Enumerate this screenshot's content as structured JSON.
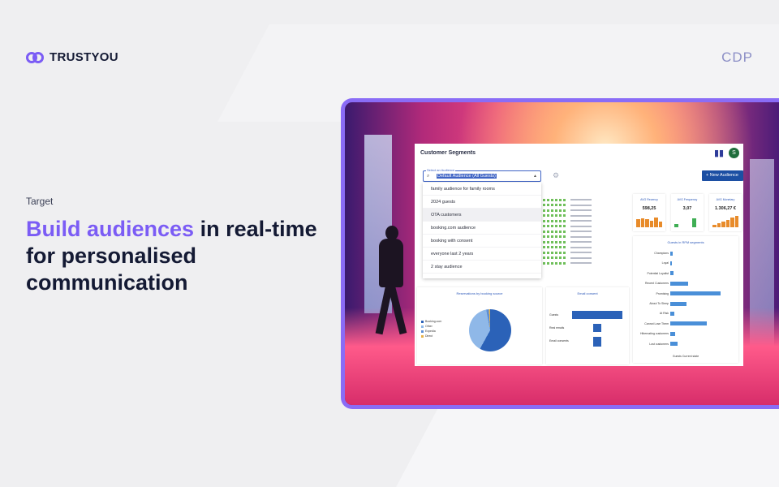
{
  "brand": {
    "name": "TRUSTYOU",
    "product": "CDP"
  },
  "hero": {
    "eyebrow": "Target",
    "headline_accent": "Build audiences",
    "headline_rest": "in real-time for personalised communication"
  },
  "app": {
    "title": "Customer Segments",
    "avatar_initial": "S",
    "select_label": "Select an Audience",
    "select_value": "Default Audience (All Guests)",
    "new_button": "+ New Audience",
    "audiences": [
      "family audience for family rooms",
      "2024 guests",
      "OTA customers",
      "booking.com audience",
      "booking with consent",
      "everyone last 2 years",
      "2 stay audience"
    ],
    "highlighted_index": 2,
    "kpis": [
      {
        "title": "AVG Recency",
        "value": "598,25",
        "bars": [
          0.7,
          0.8,
          0.75,
          0.6,
          0.85,
          0.5
        ],
        "color": "#e88b2a"
      },
      {
        "title": "AVG Frequency",
        "value": "3,07",
        "bars": [
          0.3,
          0.0,
          0.0,
          0.0,
          0.8,
          0.0
        ],
        "color": "#3fae54"
      },
      {
        "title": "AVG Monetary",
        "value": "1.306,27 €",
        "bars": [
          0.2,
          0.35,
          0.5,
          0.65,
          0.85,
          1.0
        ],
        "color": "#e88b2a"
      }
    ],
    "rfm": {
      "title": "Guests in RFM segments",
      "segments": [
        {
          "name": "Champions",
          "value": 0.04
        },
        {
          "name": "Loyal",
          "value": 0.03
        },
        {
          "name": "Potential Loyalist",
          "value": 0.05
        },
        {
          "name": "Recent Customers",
          "value": 0.28
        },
        {
          "name": "Promising",
          "value": 0.8
        },
        {
          "name": "About To Sleep",
          "value": 0.25
        },
        {
          "name": "At Risk",
          "value": 0.07
        },
        {
          "name": "Cannot Lose Them",
          "value": 0.58
        },
        {
          "name": "Hibernating customers",
          "value": 0.08
        },
        {
          "name": "Lost customers",
          "value": 0.12
        }
      ],
      "legend": "Guests  Current state"
    },
    "pie": {
      "title": "Reservations by booking source",
      "legend": [
        "Booking.com",
        "Other",
        "Expedia",
        "Direct"
      ],
      "colors": [
        "#2b62b8",
        "#8fb8e8",
        "#5c8fd6",
        "#e7b24a"
      ]
    },
    "email": {
      "title": "Email consent",
      "rows": [
        "Guests",
        "Real emails",
        "Email consents"
      ]
    }
  }
}
